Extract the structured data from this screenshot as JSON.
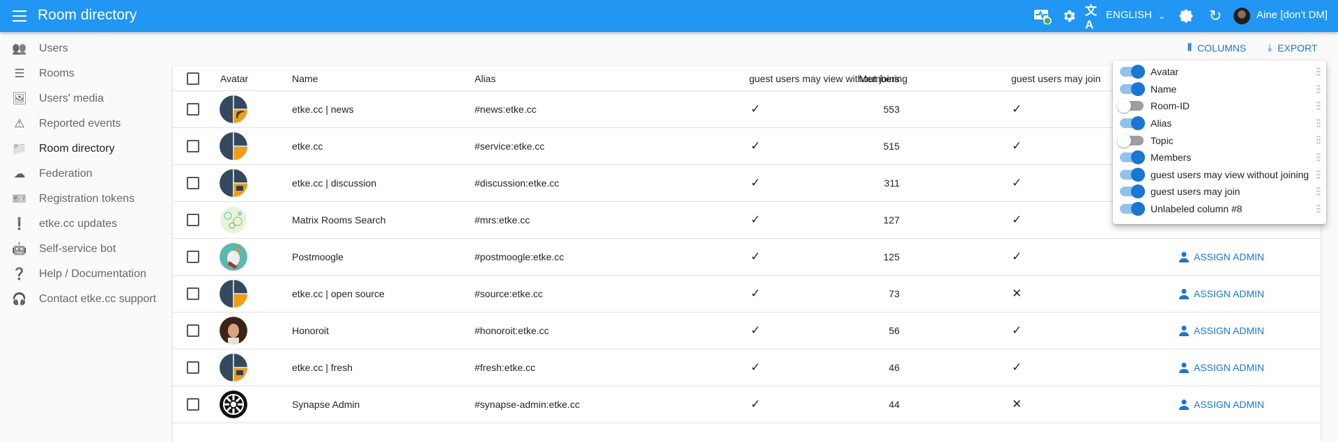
{
  "appbar": {
    "title": "Room directory",
    "language": "ENGLISH",
    "user": "Aine [don't DM]",
    "color": "#2196f3"
  },
  "sidebar": {
    "items": [
      {
        "label": "Users",
        "icon": "people-icon"
      },
      {
        "label": "Rooms",
        "icon": "list-icon"
      },
      {
        "label": "Users' media",
        "icon": "photo-library-icon"
      },
      {
        "label": "Reported events",
        "icon": "warning-icon"
      },
      {
        "label": "Room directory",
        "icon": "folder-shared-icon",
        "active": true
      },
      {
        "label": "Federation",
        "icon": "cloud-icon"
      },
      {
        "label": "Registration tokens",
        "icon": "ticket-icon"
      },
      {
        "label": "etke.cc updates",
        "icon": "announcement-icon"
      },
      {
        "label": "Self-service bot",
        "icon": "bot-icon"
      },
      {
        "label": "Help / Documentation",
        "icon": "help-icon"
      },
      {
        "label": "Contact etke.cc support",
        "icon": "support-icon"
      }
    ]
  },
  "toolbar": {
    "columns": "COLUMNS",
    "export": "EXPORT"
  },
  "table": {
    "headers": {
      "avatar": "Avatar",
      "name": "Name",
      "alias": "Alias",
      "members": "Members",
      "guest_view": "guest users may view without joining",
      "guest_join": "guest users may join"
    },
    "assign_label": "ASSIGN ADMIN",
    "rows": [
      {
        "name": "etke.cc | news",
        "alias": "#news:etke.cc",
        "members": "553",
        "view": "✓",
        "join": "✓",
        "avatar": "etke-news"
      },
      {
        "name": "etke.cc",
        "alias": "#service:etke.cc",
        "members": "515",
        "view": "✓",
        "join": "✓",
        "avatar": "etke"
      },
      {
        "name": "etke.cc | discussion",
        "alias": "#discussion:etke.cc",
        "members": "311",
        "view": "✓",
        "join": "✓",
        "avatar": "etke-discussion"
      },
      {
        "name": "Matrix Rooms Search",
        "alias": "#mrs:etke.cc",
        "members": "127",
        "view": "✓",
        "join": "✓",
        "avatar": "mrs"
      },
      {
        "name": "Postmoogle",
        "alias": "#postmoogle:etke.cc",
        "members": "125",
        "view": "✓",
        "join": "✓",
        "avatar": "postmoogle",
        "assign": true
      },
      {
        "name": "etke.cc | open source",
        "alias": "#source:etke.cc",
        "members": "73",
        "view": "✓",
        "join": "✕",
        "avatar": "etke",
        "assign": true
      },
      {
        "name": "Honoroit",
        "alias": "#honoroit:etke.cc",
        "members": "56",
        "view": "✓",
        "join": "✓",
        "avatar": "honoroit",
        "assign": true
      },
      {
        "name": "etke.cc | fresh",
        "alias": "#fresh:etke.cc",
        "members": "46",
        "view": "✓",
        "join": "✓",
        "avatar": "etke-discussion",
        "assign": true
      },
      {
        "name": "Synapse Admin",
        "alias": "#synapse-admin:etke.cc",
        "members": "44",
        "view": "✓",
        "join": "✕",
        "avatar": "synapse-admin",
        "assign": true
      }
    ]
  },
  "columns_menu": [
    {
      "label": "Avatar",
      "on": true
    },
    {
      "label": "Name",
      "on": true
    },
    {
      "label": "Room-ID",
      "on": false
    },
    {
      "label": "Alias",
      "on": true
    },
    {
      "label": "Topic",
      "on": false
    },
    {
      "label": "Members",
      "on": true
    },
    {
      "label": "guest users may view without joining",
      "on": true
    },
    {
      "label": "guest users may join",
      "on": true
    },
    {
      "label": "Unlabeled column #8",
      "on": true
    }
  ]
}
